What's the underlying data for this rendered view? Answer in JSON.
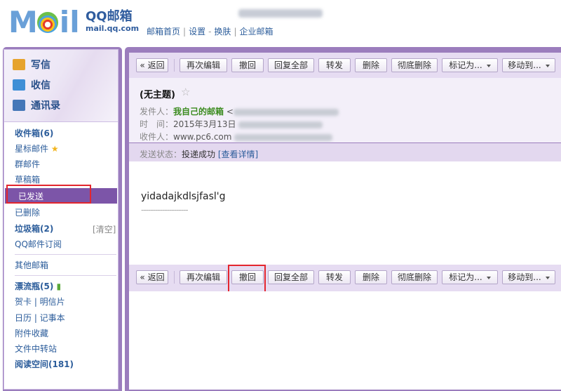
{
  "header": {
    "logo_letters": [
      "M",
      "i",
      "l"
    ],
    "brand_cn": "QQ邮箱",
    "brand_en": "mail.qq.com",
    "nav": [
      "邮箱首页",
      "设置",
      "换肤",
      "企业邮箱"
    ]
  },
  "sidebar": {
    "actions": [
      {
        "label": "写信",
        "icon": "pencil-icon",
        "color": "#e6a32d"
      },
      {
        "label": "收信",
        "icon": "inbox-tray-icon",
        "color": "#3f8fd6"
      },
      {
        "label": "通讯录",
        "icon": "contacts-icon",
        "color": "#4577b8"
      }
    ],
    "items": [
      {
        "label": "收件箱(6)",
        "bold": true
      },
      {
        "label": "星标邮件",
        "icon": "star-icon"
      },
      {
        "label": "群邮件"
      },
      {
        "label": "草稿箱"
      },
      {
        "label": "已发送",
        "selected": true
      },
      {
        "label": "已删除"
      },
      {
        "label": "垃圾箱(2)",
        "bold": true,
        "action": "[清空]"
      },
      {
        "label": "QQ邮件订阅"
      },
      {
        "label": "其他邮箱"
      },
      {
        "label": "漂流瓶(5)",
        "bold": true,
        "icon": "bottle-icon"
      },
      {
        "label": "贺卡 | 明信片"
      },
      {
        "label": "日历 | 记事本"
      },
      {
        "label": "附件收藏"
      },
      {
        "label": "文件中转站"
      },
      {
        "label": "阅读空间(181)",
        "bold": true
      }
    ]
  },
  "toolbar": {
    "back": "« 返回",
    "buttons": [
      "再次编辑",
      "撤回",
      "回复全部",
      "转发",
      "删除",
      "彻底删除"
    ],
    "dropdowns": [
      "标记为...",
      "移动到..."
    ]
  },
  "mail": {
    "subject": "(无主题)",
    "from_label": "发件人：",
    "from_name": "我自己的邮箱",
    "from_open": "<",
    "time_label": "时　间：",
    "time_value": "2015年3月13日",
    "to_label": "收件人：",
    "to_value": "www.pc6.com",
    "status_label": "发送状态：",
    "status_value": "投递成功",
    "status_link": "[查看详情]",
    "body": "yidadajkdlsjfasl'g",
    "signature_sep": "--------------------"
  },
  "colors": {
    "sidebar_frame": "#9b7dbd",
    "selected": "#7c55a8",
    "highlight": "#e3262e",
    "link": "#2c5d9b"
  }
}
